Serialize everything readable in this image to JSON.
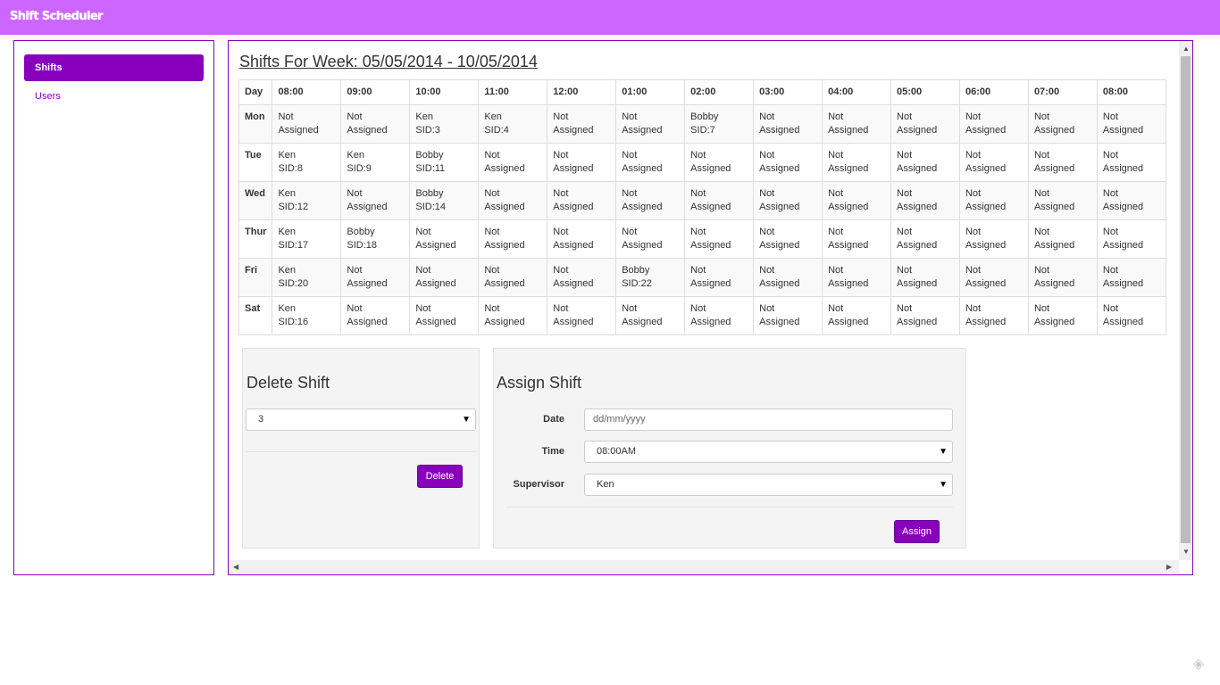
{
  "app": {
    "title": "Shift Scheduler"
  },
  "sidebar": {
    "items": [
      {
        "label": "Shifts",
        "active": true
      },
      {
        "label": "Users",
        "active": false
      }
    ]
  },
  "main": {
    "title": "Shifts For Week: 05/05/2014 - 10/05/2014",
    "table": {
      "headers": [
        "Day",
        "08:00",
        "09:00",
        "10:00",
        "11:00",
        "12:00",
        "01:00",
        "02:00",
        "03:00",
        "04:00",
        "05:00",
        "06:00",
        "07:00",
        "08:00"
      ],
      "rows": [
        {
          "day": "Mon",
          "cells": [
            [
              "Not Assigned"
            ],
            [
              "Not Assigned"
            ],
            [
              "Ken",
              "SID:3"
            ],
            [
              "Ken",
              "SID:4"
            ],
            [
              "Not Assigned"
            ],
            [
              "Not Assigned"
            ],
            [
              "Bobby",
              "SID:7"
            ],
            [
              "Not Assigned"
            ],
            [
              "Not Assigned"
            ],
            [
              "Not Assigned"
            ],
            [
              "Not Assigned"
            ],
            [
              "Not Assigned"
            ],
            [
              "Not Assigned"
            ]
          ]
        },
        {
          "day": "Tue",
          "cells": [
            [
              "Ken",
              "SID:8"
            ],
            [
              "Ken",
              "SID:9"
            ],
            [
              "Bobby",
              "SID:11"
            ],
            [
              "Not Assigned"
            ],
            [
              "Not Assigned"
            ],
            [
              "Not Assigned"
            ],
            [
              "Not Assigned"
            ],
            [
              "Not Assigned"
            ],
            [
              "Not Assigned"
            ],
            [
              "Not Assigned"
            ],
            [
              "Not Assigned"
            ],
            [
              "Not Assigned"
            ],
            [
              "Not Assigned"
            ]
          ]
        },
        {
          "day": "Wed",
          "cells": [
            [
              "Ken",
              "SID:12"
            ],
            [
              "Not Assigned"
            ],
            [
              "Bobby",
              "SID:14"
            ],
            [
              "Not Assigned"
            ],
            [
              "Not Assigned"
            ],
            [
              "Not Assigned"
            ],
            [
              "Not Assigned"
            ],
            [
              "Not Assigned"
            ],
            [
              "Not Assigned"
            ],
            [
              "Not Assigned"
            ],
            [
              "Not Assigned"
            ],
            [
              "Not Assigned"
            ],
            [
              "Not Assigned"
            ]
          ]
        },
        {
          "day": "Thur",
          "cells": [
            [
              "Ken",
              "SID:17"
            ],
            [
              "Bobby",
              "SID:18"
            ],
            [
              "Not Assigned"
            ],
            [
              "Not Assigned"
            ],
            [
              "Not Assigned"
            ],
            [
              "Not Assigned"
            ],
            [
              "Not Assigned"
            ],
            [
              "Not Assigned"
            ],
            [
              "Not Assigned"
            ],
            [
              "Not Assigned"
            ],
            [
              "Not Assigned"
            ],
            [
              "Not Assigned"
            ],
            [
              "Not Assigned"
            ]
          ]
        },
        {
          "day": "Fri",
          "cells": [
            [
              "Ken",
              "SID:20"
            ],
            [
              "Not Assigned"
            ],
            [
              "Not Assigned"
            ],
            [
              "Not Assigned"
            ],
            [
              "Not Assigned"
            ],
            [
              "Bobby",
              "SID:22"
            ],
            [
              "Not Assigned"
            ],
            [
              "Not Assigned"
            ],
            [
              "Not Assigned"
            ],
            [
              "Not Assigned"
            ],
            [
              "Not Assigned"
            ],
            [
              "Not Assigned"
            ],
            [
              "Not Assigned"
            ]
          ]
        },
        {
          "day": "Sat",
          "cells": [
            [
              "Ken",
              "SID:16"
            ],
            [
              "Not Assigned"
            ],
            [
              "Not Assigned"
            ],
            [
              "Not Assigned"
            ],
            [
              "Not Assigned"
            ],
            [
              "Not Assigned"
            ],
            [
              "Not Assigned"
            ],
            [
              "Not Assigned"
            ],
            [
              "Not Assigned"
            ],
            [
              "Not Assigned"
            ],
            [
              "Not Assigned"
            ],
            [
              "Not Assigned"
            ],
            [
              "Not Assigned"
            ]
          ]
        }
      ]
    }
  },
  "delete_shift": {
    "title": "Delete Shift",
    "selected": "3",
    "button": "Delete"
  },
  "assign_shift": {
    "title": "Assign Shift",
    "date_label": "Date",
    "date_placeholder": "dd/mm/yyyy",
    "time_label": "Time",
    "time_value": "08:00AM",
    "supervisor_label": "Supervisor",
    "supervisor_value": "Ken",
    "button": "Assign"
  },
  "icons": {
    "caret": "chevron-down-icon",
    "corner": "tag-icon"
  },
  "colors": {
    "header_bar": "#cc66ff",
    "accent": "#8800bb"
  }
}
